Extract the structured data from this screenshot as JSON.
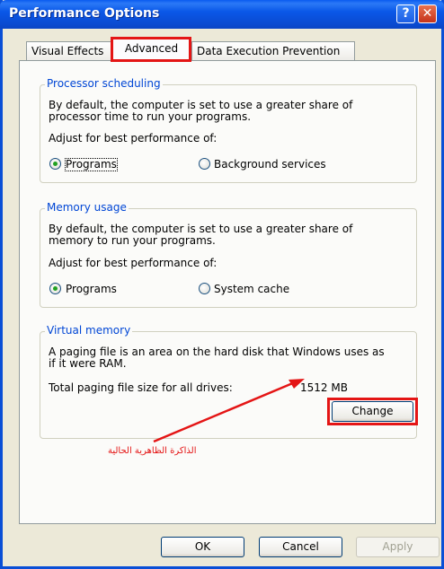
{
  "window": {
    "title": "Performance Options",
    "help_glyph": "?",
    "close_glyph": "✕"
  },
  "tabs": [
    {
      "label": "Visual Effects"
    },
    {
      "label": "Advanced"
    },
    {
      "label": "Data Execution Prevention"
    }
  ],
  "processor": {
    "legend": "Processor scheduling",
    "desc_line1": "By default, the computer is set to use a greater share of",
    "desc_line2": "processor time to run your programs.",
    "adjust_label": "Adjust for best performance of:",
    "option_programs": "Programs",
    "option_background": "Background services",
    "selected": "Programs"
  },
  "memory": {
    "legend": "Memory usage",
    "desc_line1": "By default, the computer is set to use a greater share of",
    "desc_line2": "memory to run your programs.",
    "adjust_label": "Adjust for best performance of:",
    "option_programs": "Programs",
    "option_system_cache": "System cache",
    "selected": "Programs"
  },
  "virtual_memory": {
    "legend": "Virtual memory",
    "desc_line1": "A paging file is an area on the hard disk that Windows uses as",
    "desc_line2": "if it were RAM.",
    "total_label": "Total paging file size for all drives:",
    "total_value": "1512 MB",
    "change_button": "Change"
  },
  "annotation": {
    "arabic_text": "الذاكرة الظاهرية الحالية",
    "highlight_color": "#e41515"
  },
  "footer": {
    "ok": "OK",
    "cancel": "Cancel",
    "apply": "Apply"
  }
}
